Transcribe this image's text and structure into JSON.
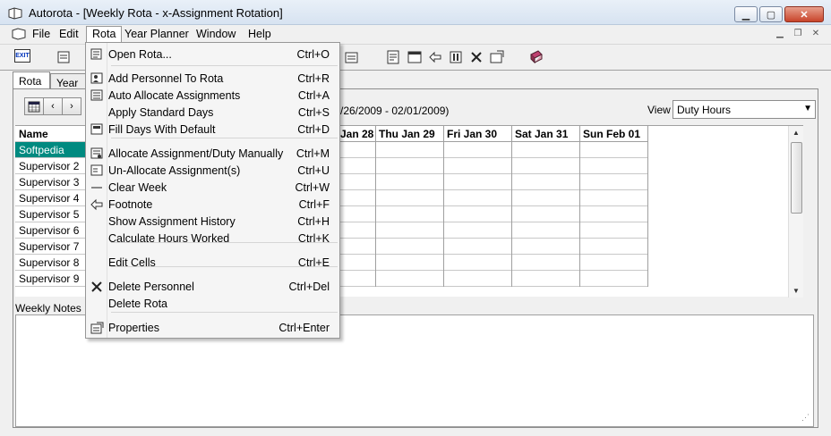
{
  "window": {
    "title": "Autorota - [Weekly Rota - x-Assignment Rotation]"
  },
  "menubar": {
    "items": [
      "File",
      "Edit",
      "Rota",
      "Year Planner",
      "Window",
      "Help"
    ]
  },
  "tabs": [
    "Rota",
    "Year P"
  ],
  "date_range": "/26/2009 - 02/01/2009)",
  "view": {
    "label": "View",
    "selected": "Duty Hours"
  },
  "grid": {
    "name_header": "Name",
    "names": [
      "Softpedia",
      "Supervisor 2",
      "Supervisor 3",
      "Supervisor 4",
      "Supervisor 5",
      "Supervisor 6",
      "Supervisor 7",
      "Supervisor 8",
      "Supervisor 9"
    ],
    "day_headers": [
      "Jan 28",
      "Thu Jan 29",
      "Fri Jan 30",
      "Sat Jan 31",
      "Sun Feb 01"
    ]
  },
  "notes_label": "Weekly Notes",
  "rota_menu": [
    {
      "label": "Open Rota...",
      "shortcut": "Ctrl+O",
      "icon": "open-rota-icon"
    },
    {
      "label": "Add Personnel To Rota",
      "shortcut": "Ctrl+R",
      "icon": "add-personnel-icon"
    },
    {
      "label": "Auto Allocate Assignments",
      "shortcut": "Ctrl+A",
      "icon": "auto-allocate-icon"
    },
    {
      "label": "Apply Standard Days",
      "shortcut": "Ctrl+S",
      "icon": ""
    },
    {
      "label": "Fill Days With Default",
      "shortcut": "Ctrl+D",
      "icon": "fill-days-icon"
    },
    {
      "label": "Allocate Assignment/Duty Manually",
      "shortcut": "Ctrl+M",
      "icon": "allocate-manual-icon"
    },
    {
      "label": "Un-Allocate Assignment(s)",
      "shortcut": "Ctrl+U",
      "icon": "unallocate-icon"
    },
    {
      "label": "Clear Week",
      "shortcut": "Ctrl+W",
      "icon": "clear-week-icon"
    },
    {
      "label": "Footnote",
      "shortcut": "Ctrl+F",
      "icon": "footnote-icon"
    },
    {
      "label": "Show Assignment History",
      "shortcut": "Ctrl+H",
      "icon": ""
    },
    {
      "label": "Calculate Hours Worked",
      "shortcut": "Ctrl+K",
      "icon": ""
    },
    {
      "label": "Edit Cells",
      "shortcut": "Ctrl+E",
      "icon": ""
    },
    {
      "label": "Delete Personnel",
      "shortcut": "Ctrl+Del",
      "icon": "delete-x-icon"
    },
    {
      "label": "Delete Rota",
      "shortcut": "",
      "icon": ""
    },
    {
      "label": "Properties",
      "shortcut": "Ctrl+Enter",
      "icon": "properties-icon"
    }
  ],
  "colors": {
    "selected_row": "#008a80",
    "titlebar": "#d7e3f1"
  }
}
